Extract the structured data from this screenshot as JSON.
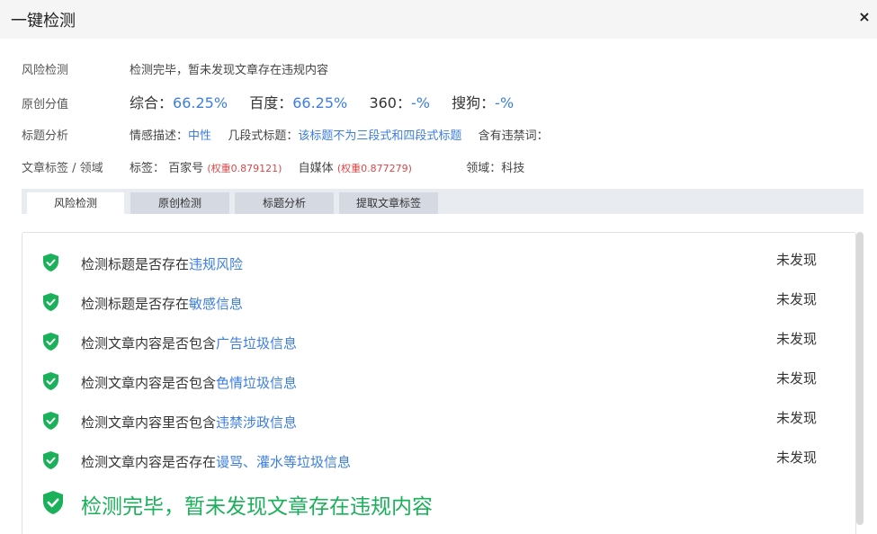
{
  "dialog": {
    "title": "一键检测",
    "close_glyph": "×"
  },
  "info": {
    "risk": {
      "label": "风险检测",
      "value": "检测完毕，暂未发现文章存在违规内容"
    },
    "original": {
      "label": "原创分值",
      "items": [
        {
          "name": "综合：",
          "value": "66.25%"
        },
        {
          "name": "百度：",
          "value": "66.25%"
        },
        {
          "name": "360：",
          "value": "-%"
        },
        {
          "name": "搜狗：",
          "value": "-%"
        }
      ]
    },
    "title_analysis": {
      "label": "标题分析",
      "emotion_label": "情感描述：",
      "emotion_value": "中性",
      "segment_label": "几段式标题：",
      "segment_value": "该标题不为三段式和四段式标题",
      "banned_label": "含有违禁词："
    },
    "tags": {
      "label": "文章标签 / 领域",
      "tag_label": "标签：",
      "tags": [
        {
          "name": "百家号",
          "weight": "(权重0.879121)"
        },
        {
          "name": "自媒体",
          "weight": "(权重0.877279)"
        }
      ],
      "domain": "领域：科技"
    }
  },
  "tabs": [
    {
      "label": "风险检测",
      "active": true
    },
    {
      "label": "原创检测",
      "active": false
    },
    {
      "label": "标题分析",
      "active": false
    },
    {
      "label": "提取文章标签",
      "active": false
    }
  ],
  "checks": [
    {
      "prefix": "检测标题是否存在",
      "highlight": "违规风险",
      "status": "未发现"
    },
    {
      "prefix": "检测标题是否存在",
      "highlight": "敏感信息",
      "status": "未发现"
    },
    {
      "prefix": "检测文章内容是否包含",
      "highlight": "广告垃圾信息",
      "status": "未发现"
    },
    {
      "prefix": "检测文章内容是否包含",
      "highlight": "色情垃圾信息",
      "status": "未发现"
    },
    {
      "prefix": "检测文章内容里否包含",
      "highlight": "违禁涉政信息",
      "status": "未发现"
    },
    {
      "prefix": "检测文章内容是否存在",
      "highlight": "谩骂、灌水等垃圾信息",
      "status": "未发现"
    }
  ],
  "summary": {
    "text": "检测完毕，暂未发现文章存在违规内容"
  },
  "colors": {
    "accent": "#3d7ee0",
    "success": "#1bb15a",
    "weight": "#e04545"
  },
  "icons": {
    "check": "shield-check-icon",
    "close": "close-icon"
  }
}
